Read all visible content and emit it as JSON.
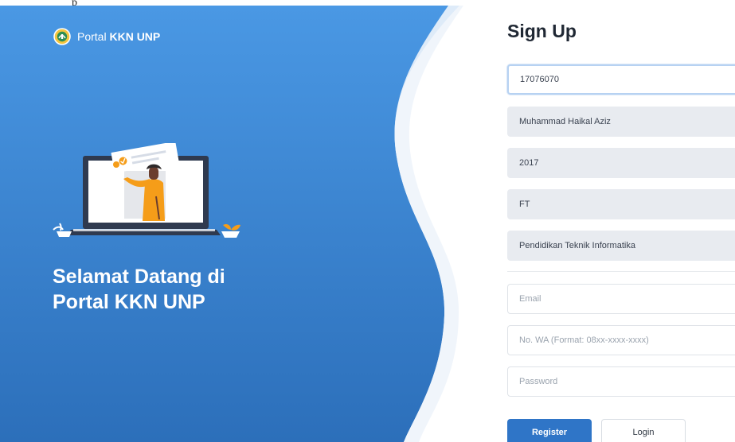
{
  "page": {
    "top_fragment": "p"
  },
  "brand": {
    "prefix": "Portal ",
    "name": "KKN UNP",
    "logo_icon": "unp-seal-icon"
  },
  "hero": {
    "welcome_line1": "Selamat Datang di",
    "welcome_line2": "Portal KKN UNP",
    "illustration": "person-presenting-on-laptop-illustration"
  },
  "form": {
    "title": "Sign Up",
    "fields": [
      {
        "value": "17076070",
        "placeholder": ""
      },
      {
        "value": "Muhammad Haikal Aziz",
        "placeholder": ""
      },
      {
        "value": "2017",
        "placeholder": ""
      },
      {
        "value": "FT",
        "placeholder": ""
      },
      {
        "value": "Pendidikan Teknik Informatika",
        "placeholder": ""
      },
      {
        "value": "",
        "placeholder": "Email"
      },
      {
        "value": "",
        "placeholder": "No. WA (Format: 08xx-xxxx-xxxx)"
      },
      {
        "value": "",
        "placeholder": "Password"
      }
    ],
    "register_label": "Register",
    "login_label": "Login"
  },
  "colors": {
    "primary": "#2f75c7",
    "hero_top": "#4a98e4",
    "hero_bottom": "#2c6fba"
  }
}
